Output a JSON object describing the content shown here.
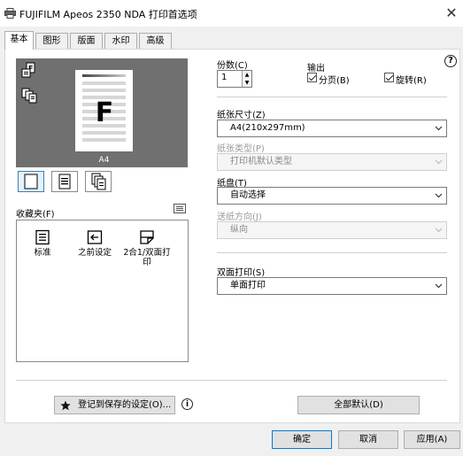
{
  "window": {
    "title": "FUJIFILM Apeos 2350 NDA 打印首选项",
    "close_glyph": "✕"
  },
  "tabs": [
    {
      "label": "基本",
      "active": true
    },
    {
      "label": "图形"
    },
    {
      "label": "版面"
    },
    {
      "label": "水印"
    },
    {
      "label": "高级"
    }
  ],
  "preview": {
    "page_letter": "F",
    "paper_label": "A4"
  },
  "favorites": {
    "label": "收藏夹(F)",
    "items": [
      {
        "label": "标准",
        "icon": "list-icon"
      },
      {
        "label": "之前设定",
        "icon": "return-icon"
      },
      {
        "label": "2合1/双面打印",
        "icon": "duplex-icon"
      }
    ]
  },
  "copies": {
    "label": "份数(C)",
    "value": "1"
  },
  "output": {
    "label": "输出",
    "collate": {
      "label": "分页(B)",
      "checked": true
    },
    "rotate": {
      "label": "旋转(R)",
      "checked": true
    }
  },
  "paper_size": {
    "label": "纸张尺寸(Z)",
    "value": "A4(210x297mm)"
  },
  "paper_type": {
    "label": "纸张类型(P)",
    "value": "打印机默认类型"
  },
  "tray": {
    "label": "纸盘(T)",
    "value": "自动选择"
  },
  "feed_direction": {
    "label": "送纸方向(J)",
    "value": "纵向"
  },
  "duplex": {
    "label": "双面打印(S)",
    "value": "单面打印"
  },
  "buttons": {
    "save_settings": "登记到保存的设定(O)...",
    "restore_defaults": "全部默认(D)",
    "ok": "确定",
    "cancel": "取消",
    "apply": "应用(A)"
  },
  "help_glyph": "?",
  "info_glyph": "i",
  "colors": {
    "accent": "#0078d7",
    "preview_bg": "#707070",
    "panel_bg": "#ffffff",
    "window_bg": "#f0f0f0"
  }
}
